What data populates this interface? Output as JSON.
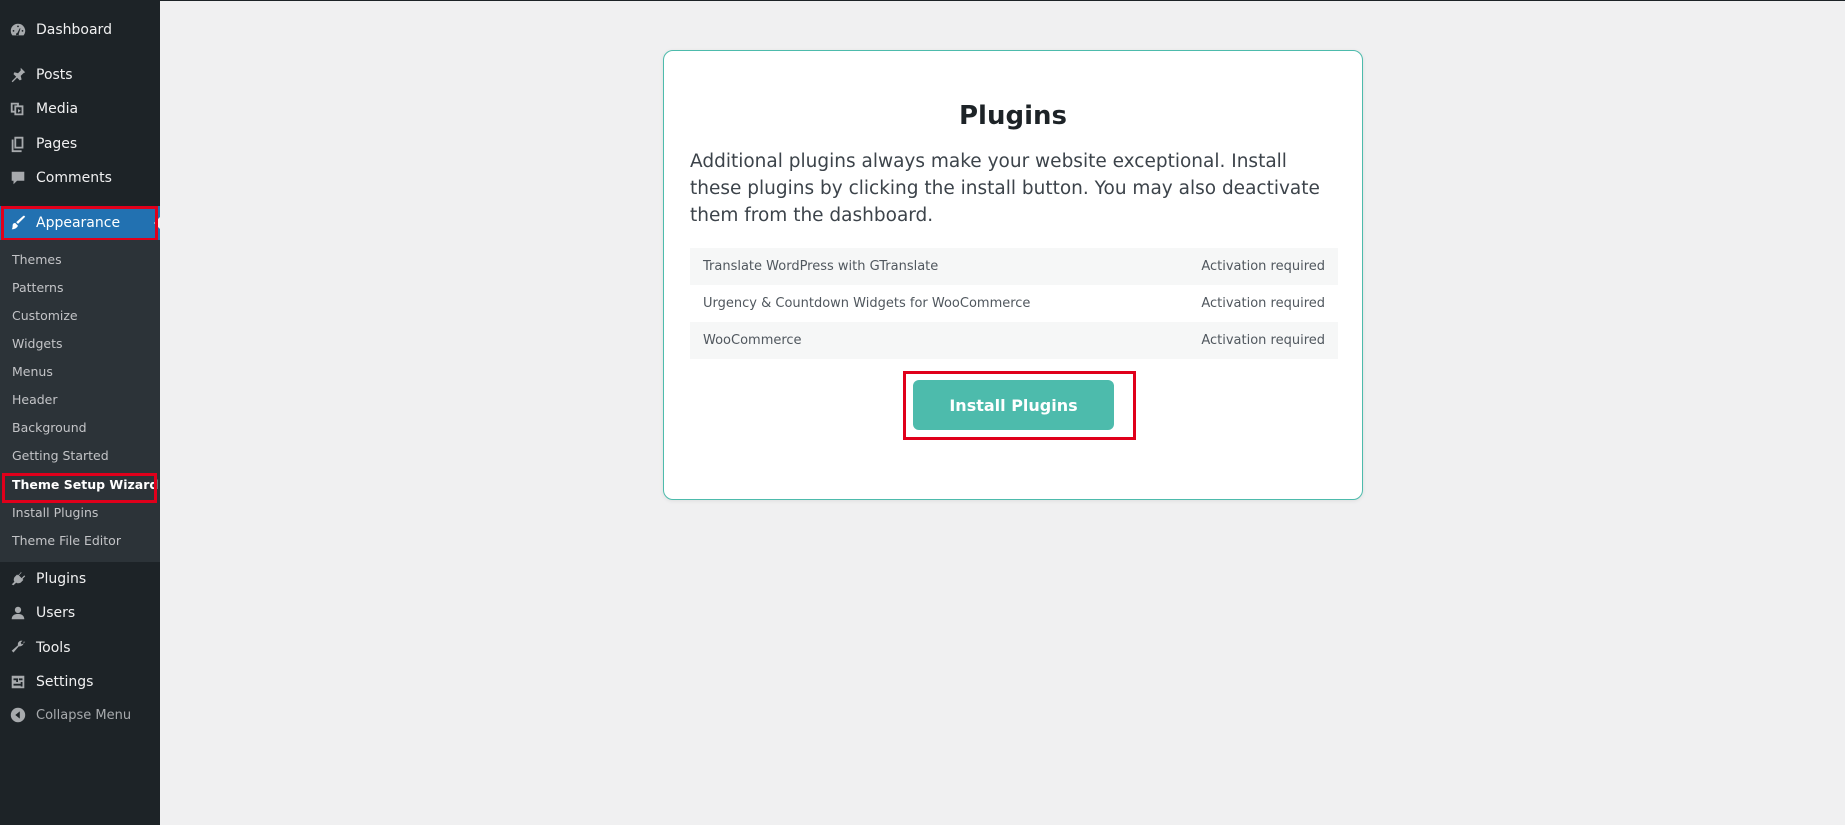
{
  "sidebar": {
    "items": [
      {
        "id": "dashboard",
        "label": "Dashboard",
        "icon": "dashboard-icon"
      },
      {
        "id": "posts",
        "label": "Posts",
        "icon": "pin-icon"
      },
      {
        "id": "media",
        "label": "Media",
        "icon": "media-icon"
      },
      {
        "id": "pages",
        "label": "Pages",
        "icon": "pages-icon"
      },
      {
        "id": "comments",
        "label": "Comments",
        "icon": "comment-icon"
      },
      {
        "id": "appearance",
        "label": "Appearance",
        "icon": "paintbrush-icon"
      },
      {
        "id": "plugins",
        "label": "Plugins",
        "icon": "plug-icon"
      },
      {
        "id": "users",
        "label": "Users",
        "icon": "user-icon"
      },
      {
        "id": "tools",
        "label": "Tools",
        "icon": "wrench-icon"
      },
      {
        "id": "settings",
        "label": "Settings",
        "icon": "settings-icon"
      }
    ],
    "collapse_label": "Collapse Menu",
    "submenu": [
      "Themes",
      "Patterns",
      "Customize",
      "Widgets",
      "Menus",
      "Header",
      "Background",
      "Getting Started",
      "Theme Setup Wizard",
      "Install Plugins",
      "Theme File Editor"
    ],
    "active_submenu": "Theme Setup Wizard",
    "accent_color": "#2271b1"
  },
  "card": {
    "title": "Plugins",
    "description": "Additional plugins always make your website exceptional. Install these plugins by clicking the install button. You may also deactivate them from the dashboard.",
    "plugins": [
      {
        "name": "Translate WordPress with GTranslate",
        "status": "Activation required"
      },
      {
        "name": "Urgency & Countdown Widgets for WooCommerce",
        "status": "Activation required"
      },
      {
        "name": "WooCommerce",
        "status": "Activation required"
      }
    ],
    "install_button_label": "Install Plugins",
    "accent_color": "#4dbbac"
  },
  "highlight_color": "#e0001b"
}
